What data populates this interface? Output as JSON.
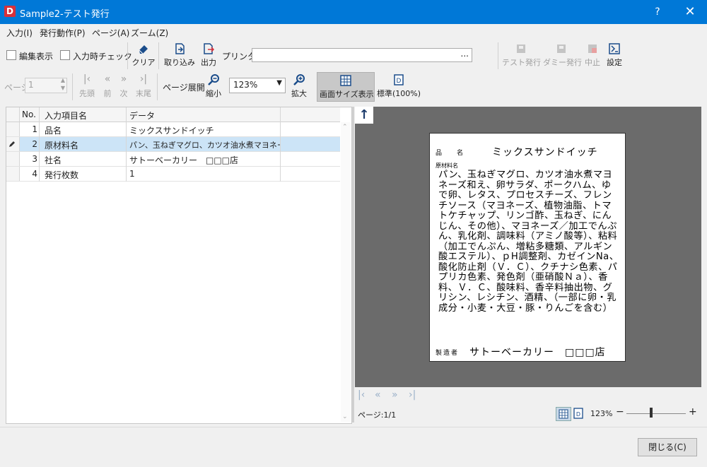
{
  "window": {
    "app_icon_letter": "D",
    "title": "Sample2-テスト発行",
    "help": "?",
    "close": "✕"
  },
  "menu": [
    "入力(I)",
    "発行動作(P)",
    "ページ(A)",
    "ズーム(Z)"
  ],
  "toolbar": {
    "edit_view": "編集表示",
    "input_check": "入力時チェック",
    "clear": "クリア",
    "import": "取り込み",
    "output": "出力",
    "printer_label": "プリンタ:",
    "printer_value": "",
    "printer_browse": "...",
    "test_issue": "テスト発行",
    "dummy_issue": "ダミー発行",
    "stop": "中止",
    "settings": "設定",
    "page_label": "ページ",
    "page_value": "1",
    "first": "先頭",
    "prev": "前",
    "next": "次",
    "last": "末尾",
    "page_spread": "ページ展開",
    "zoom_out": "縮小",
    "zoom_value": "123%",
    "zoom_in": "拡大",
    "fit_screen": "画面サイズ表示",
    "standard": "標準(100%)"
  },
  "grid": {
    "headers": [
      "No.",
      "入力項目名",
      "データ"
    ],
    "rows": [
      {
        "no": "1",
        "name": "品名",
        "data": "ミックスサンドイッチ"
      },
      {
        "no": "2",
        "name": "原材料名",
        "data": "パン、玉ねぎマグロ、カツオ油水煮マヨネーズ和"
      },
      {
        "no": "3",
        "name": "社名",
        "data": "サトーベーカリー　□□□店"
      },
      {
        "no": "4",
        "name": "発行枚数",
        "data": "1"
      }
    ],
    "selected_row": 2
  },
  "preview": {
    "name_label": "品　名",
    "name_value": "ミックスサンドイッチ",
    "materials_label": "原材料名",
    "materials_value": "パン、玉ねぎマグロ、カツオ油水煮マヨネーズ和え、卵サラダ、ポークハム、ゆで卵、レタス、プロセスチーズ、フレンチソース（マヨネーズ、植物油脂、トマトケチャップ、リンゴ酢、玉ねぎ、にんじん、その他）、マヨネーズ／加工でんぷん、乳化剤、調味料（アミノ酸等）、粘料（加工でんぷん、増粘多糖類、アルギン酸エステル）、ｐH調整剤、カゼインNa、酸化防止剤（Ｖ．Ｃ）、クチナシ色素、パプリカ色素、発色剤（亜硝酸Ｎａ）、香料、Ｖ．Ｃ、酸味料、香辛料抽出物、グリシン、レシチン、酒精、（一部に卵・乳成分・小麦・大豆・豚・りんごを含む）",
    "maker_label": "製造者",
    "maker_value": "サトーベーカリー　□□□店"
  },
  "status": {
    "page": "ページ:1/1",
    "zoom": "123%",
    "zoom_level": 0.42
  },
  "footer": {
    "close": "閉じる(C)"
  }
}
